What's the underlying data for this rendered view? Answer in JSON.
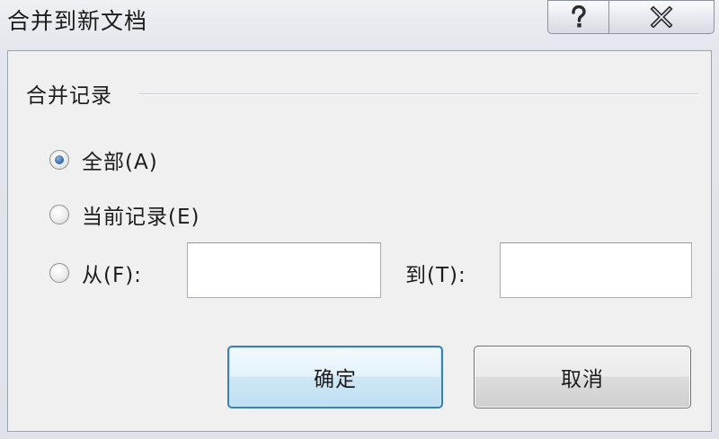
{
  "window": {
    "title": "合并到新文档"
  },
  "controls": {
    "help_icon": "question-mark-icon",
    "close_icon": "close-x-icon"
  },
  "group": {
    "label": "合并记录"
  },
  "options": {
    "all_label": "全部(A)",
    "current_label": "当前记录(E)",
    "from_label": "从(F):",
    "selected": "all"
  },
  "range": {
    "from_value": "",
    "to_label": "到(T):",
    "to_value": ""
  },
  "buttons": {
    "ok_label": "确定",
    "cancel_label": "取消"
  },
  "colors": {
    "accent_border": "#3c7fb1",
    "radio_dot": "#3a6fb0"
  }
}
